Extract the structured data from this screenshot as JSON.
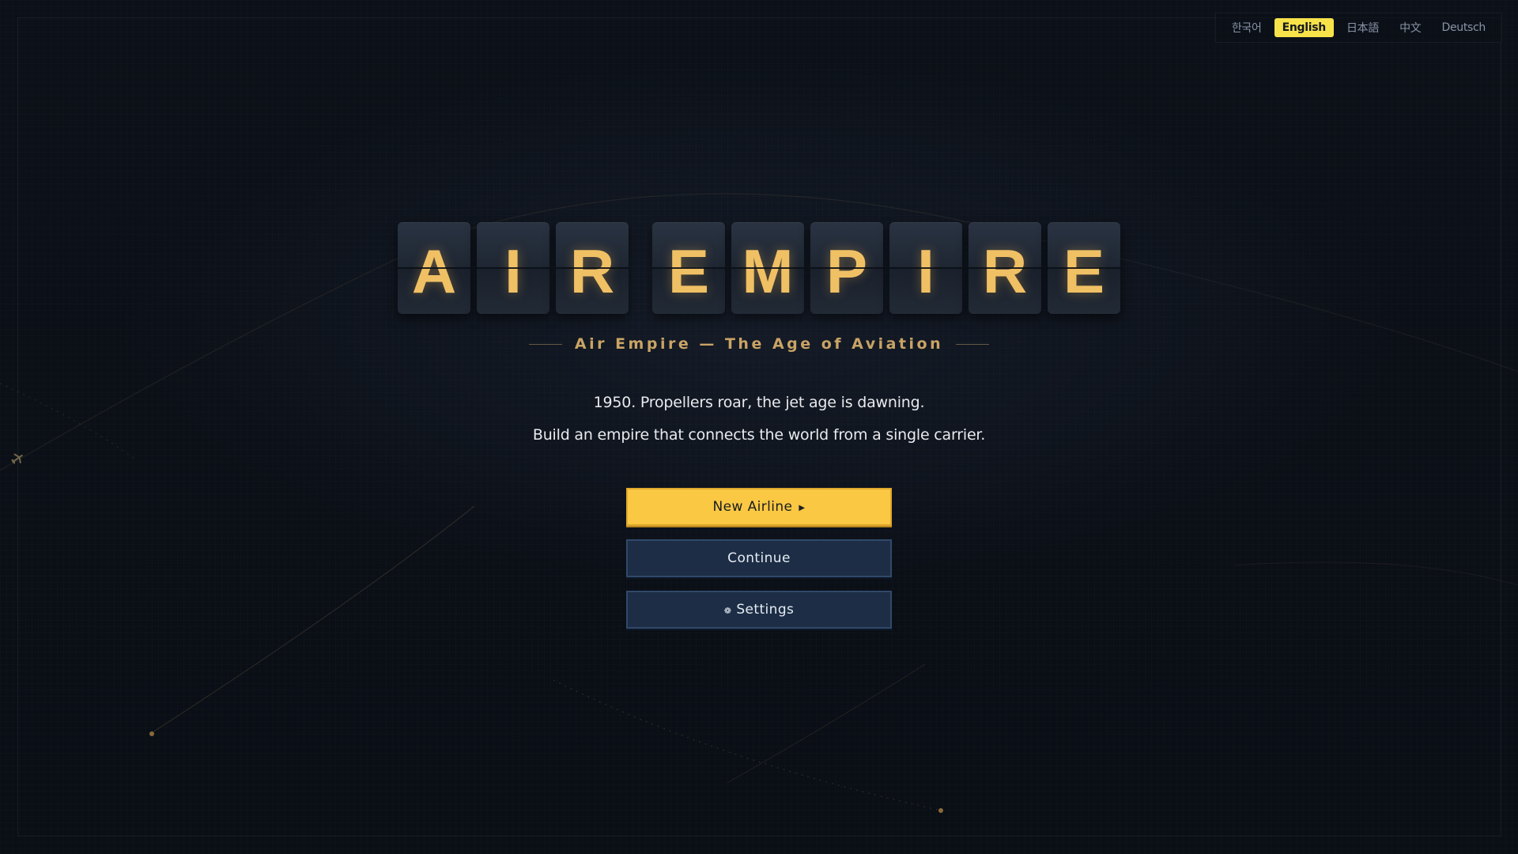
{
  "languages": {
    "korean": "한국어",
    "english": "English",
    "japanese": "日本語",
    "chinese": "中文",
    "german": "Deutsch",
    "active": "English"
  },
  "title": {
    "letters": [
      "A",
      "I",
      "R",
      "E",
      "M",
      "P",
      "I",
      "R",
      "E"
    ],
    "subtitle": "Air Empire — The Age of Aviation"
  },
  "intro": {
    "line1": "1950. Propellers roar, the jet age is dawning.",
    "line2": "Build an empire that connects the world from a single carrier."
  },
  "menu": {
    "new_airline": "New Airline",
    "new_airline_icon": "play-triangle-icon",
    "continue": "Continue",
    "settings": "Settings",
    "settings_icon": "gear-icon"
  },
  "colors": {
    "background": "#0b0f17",
    "accent_gold": "#f0c064",
    "primary_button": "#fac843",
    "secondary_button": "#1c2d45",
    "active_language": "#f7e24a"
  }
}
